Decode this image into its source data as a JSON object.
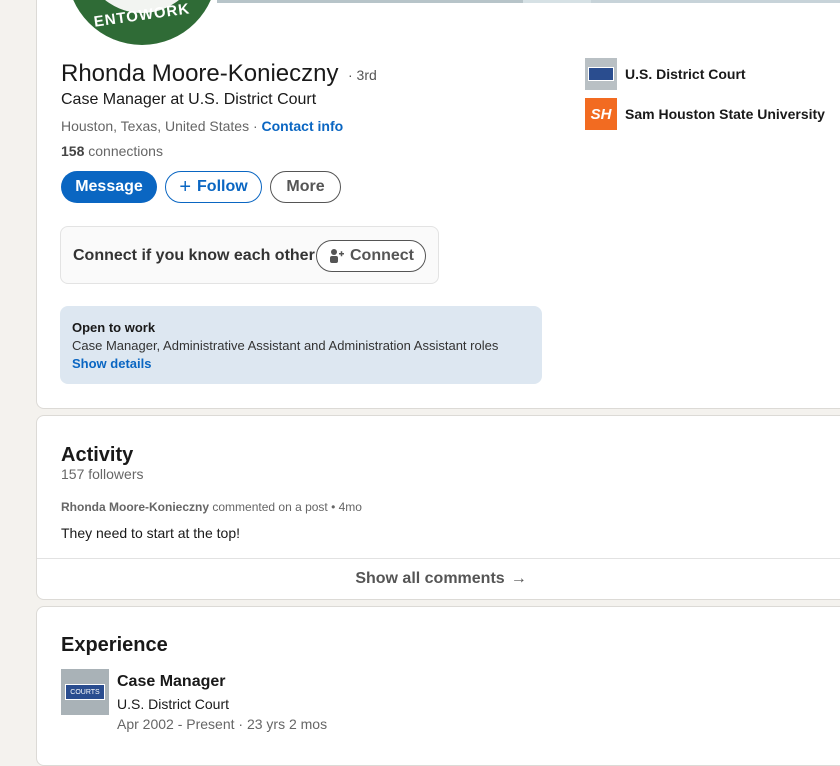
{
  "profile": {
    "avatar_text": "ENTOWORK",
    "name": "Rhonda Moore-Konieczny",
    "degree": "· 3rd",
    "headline": "Case Manager at U.S. District Court",
    "location": "Houston, Texas, United States ·",
    "contact_link": "Contact info",
    "connections_count": "158",
    "connections_label": "connections"
  },
  "actions": {
    "message": "Message",
    "follow": "Follow",
    "more": "More"
  },
  "connect_box": {
    "text": "Connect if you know each other",
    "button": "Connect"
  },
  "open_to_work": {
    "title": "Open to work",
    "roles": "Case Manager, Administrative Assistant and Administration Assistant roles",
    "link": "Show details"
  },
  "orgs": [
    {
      "name": "U.S. District Court",
      "logo": "court-seal-icon"
    },
    {
      "name": "Sam Houston State University",
      "logo": "sh-logo-icon",
      "logo_text": "SH"
    }
  ],
  "activity": {
    "title": "Activity",
    "followers": "157 followers",
    "post_author": "Rhonda Moore-Konieczny",
    "post_action": "commented on a post • 4mo",
    "post_text": "They need to start at the top!",
    "show_all": "Show all comments"
  },
  "experience": {
    "title": "Experience",
    "items": [
      {
        "title": "Case Manager",
        "company": "U.S. District Court",
        "dates": "Apr 2002 - Present · 23 yrs 2 mos",
        "logo_text": "COURTS"
      }
    ]
  },
  "colors": {
    "accent": "#0a66c2",
    "otw_bg": "#dde7f1",
    "shsu_orange": "#f26b21"
  }
}
